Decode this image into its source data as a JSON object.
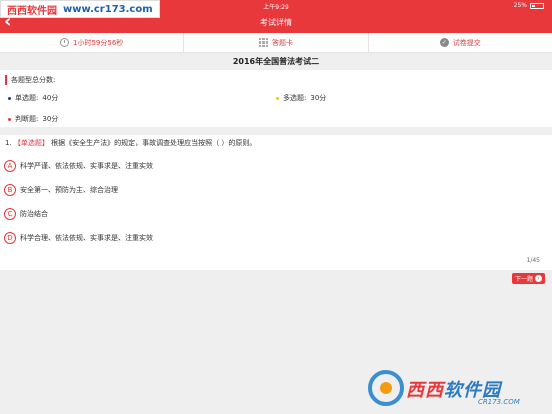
{
  "status": {
    "time": "上午9:29",
    "battery": "25%"
  },
  "watermark_top": {
    "site_name": "西西软件园",
    "url": "www.cr173.com"
  },
  "header": {
    "title": "考试详情",
    "back_icon": "chevron-left-icon"
  },
  "toolbar": {
    "timer_label": "1小时59分56秒",
    "card_label": "答题卡",
    "submit_label": "试卷提交"
  },
  "exam": {
    "title": "2016年全国普法考试二"
  },
  "scores": {
    "heading": "各题型总分数:",
    "items": [
      {
        "label": "单选题:",
        "value": "40分",
        "dot_color": "#1d3f8a"
      },
      {
        "label": "多选题:",
        "value": "30分",
        "dot_color": "#f5c518"
      },
      {
        "label": "判断题:",
        "value": "30分",
        "dot_color": "#e8383b"
      }
    ]
  },
  "question": {
    "number": "1.",
    "type": "【单选题】",
    "text": "根据《安全生产法》的规定，事故调查处理应当按照（ ）的原则。",
    "options": [
      {
        "letter": "A",
        "text": "科学严谨、依法依规、实事求是、注重实效"
      },
      {
        "letter": "B",
        "text": "安全第一、预防为主、综合治理"
      },
      {
        "letter": "C",
        "text": "防治结合"
      },
      {
        "letter": "D",
        "text": "科学合理、依法依规、实事求是、注重实效"
      }
    ],
    "page_indicator": "1/45"
  },
  "navigation": {
    "next_label": "下一题"
  },
  "watermark_bottom": {
    "brand_a": "西西",
    "brand_b": "软件园",
    "url": "CR173.COM"
  },
  "colors": {
    "accent": "#e8383b",
    "background": "#efefef"
  }
}
